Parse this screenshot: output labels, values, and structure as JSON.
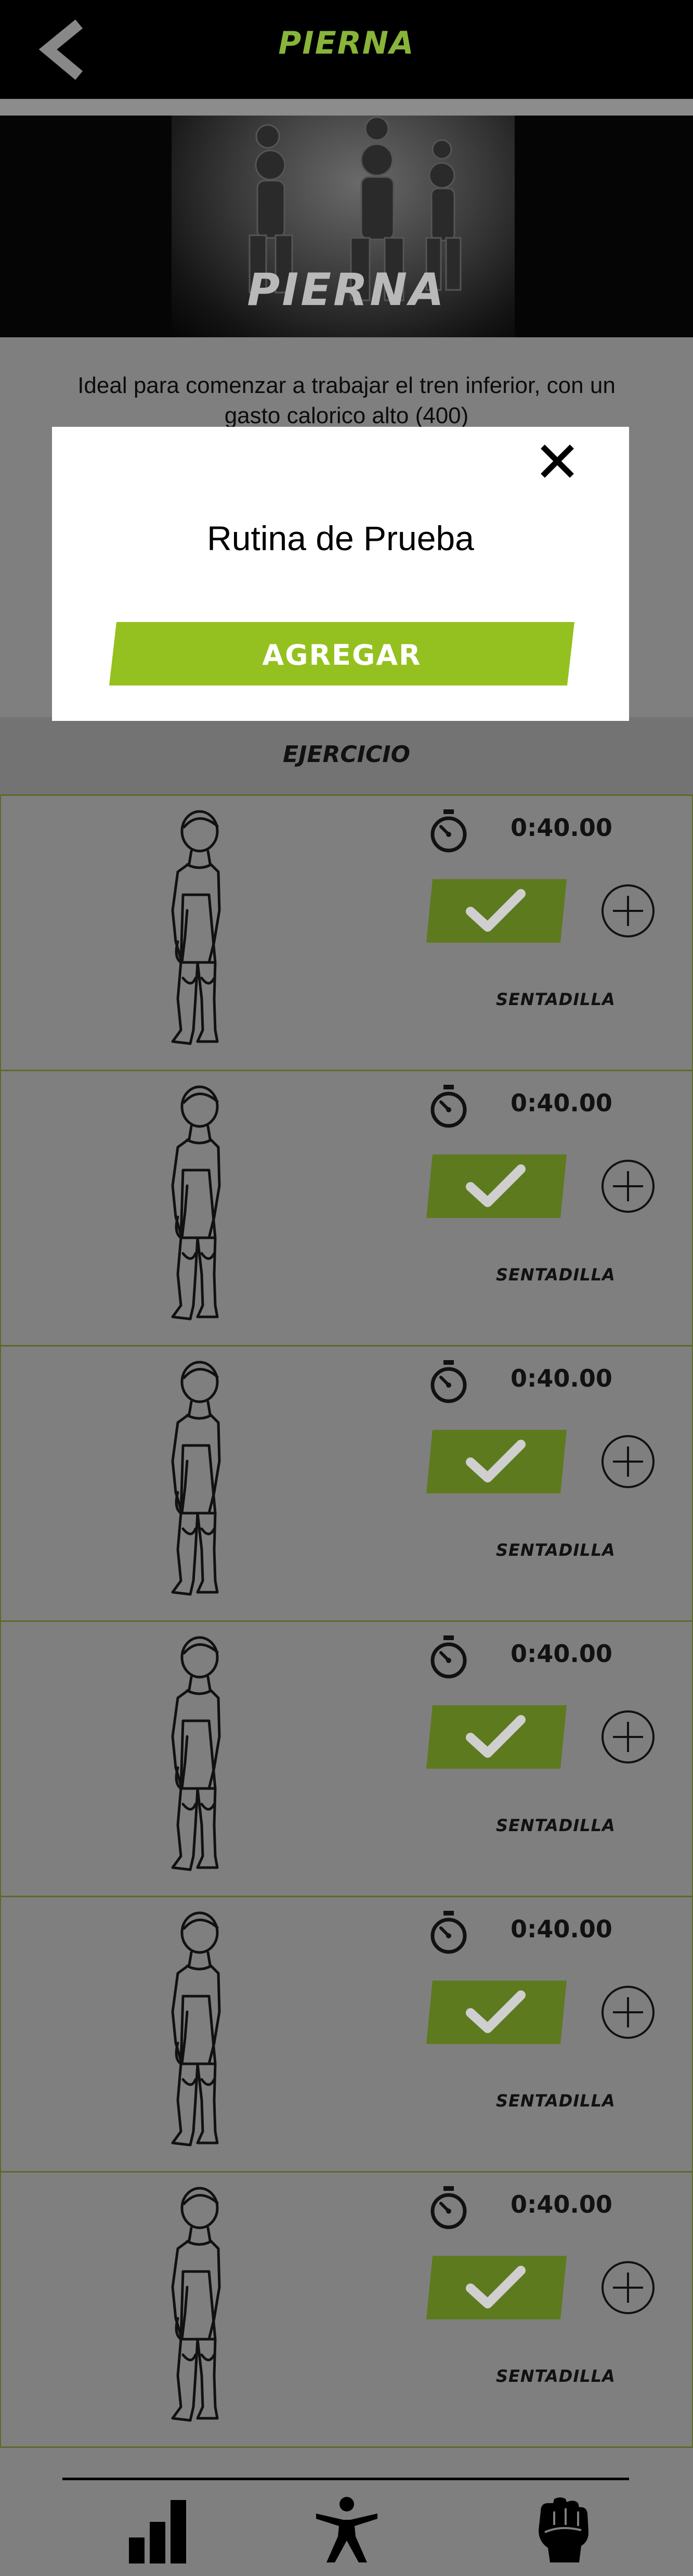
{
  "header": {
    "title": "PIERNA"
  },
  "hero": {
    "title": "PIERNA"
  },
  "description": "Ideal para comenzar a trabajar el tren inferior, con un gasto calorico alto (400)",
  "section": {
    "label": "EJERCICIO"
  },
  "exercises": [
    {
      "time": "0:40.00",
      "name": "SENTADILLA"
    },
    {
      "time": "0:40.00",
      "name": "SENTADILLA"
    },
    {
      "time": "0:40.00",
      "name": "SENTADILLA"
    },
    {
      "time": "0:40.00",
      "name": "SENTADILLA"
    },
    {
      "time": "0:40.00",
      "name": "SENTADILLA"
    },
    {
      "time": "0:40.00",
      "name": "SENTADILLA"
    }
  ],
  "modal": {
    "title": "Rutina de Prueba",
    "add_label": "AGREGAR"
  },
  "icons": {
    "back": "chevron-left-icon",
    "close": "close-icon",
    "timer": "stopwatch-icon",
    "check": "check-icon",
    "plus": "plus-circle-icon",
    "nav": [
      "bar-chart-icon",
      "person-icon",
      "fist-icon"
    ]
  },
  "colors": {
    "accent": "#88b43a",
    "accent_dim": "#5d7a1e",
    "header_bg": "#000000"
  }
}
